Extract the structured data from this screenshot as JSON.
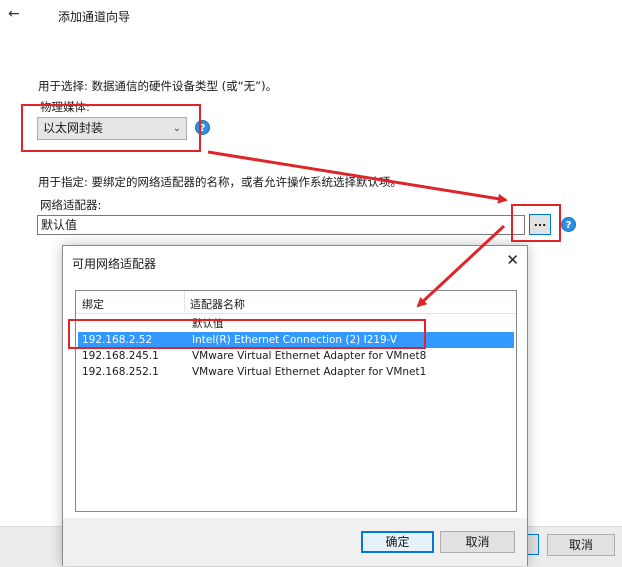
{
  "wizard": {
    "title": "添加通道向导",
    "medium_description": "用于选择: 数据通信的硬件设备类型 (或“无”)。",
    "medium_label": "物理媒体:",
    "medium_value": "以太网封装",
    "adapter_description": "用于指定: 要绑定的网络适配器的名称，或者允许操作系统选择默认项。",
    "adapter_label": "网络适配器:",
    "adapter_value": "默认值",
    "browse_label": "...",
    "help_glyph": "?",
    "cancel_label": "取消"
  },
  "dialog": {
    "title": "可用网络适配器",
    "columns": [
      "绑定",
      "适配器名称"
    ],
    "rows": [
      {
        "binding": "",
        "name": "默认值",
        "selected": false
      },
      {
        "binding": "192.168.2.52",
        "name": "Intel(R) Ethernet Connection (2) I219-V",
        "selected": true
      },
      {
        "binding": "192.168.245.1",
        "name": "VMware Virtual Ethernet Adapter for VMnet8",
        "selected": false
      },
      {
        "binding": "192.168.252.1",
        "name": "VMware Virtual Ethernet Adapter for VMnet1",
        "selected": false
      }
    ],
    "ok_label": "确定",
    "cancel_label": "取消"
  },
  "colors": {
    "annotation": "#e0252a",
    "selection": "#3399ff",
    "accent": "#0078d7"
  }
}
